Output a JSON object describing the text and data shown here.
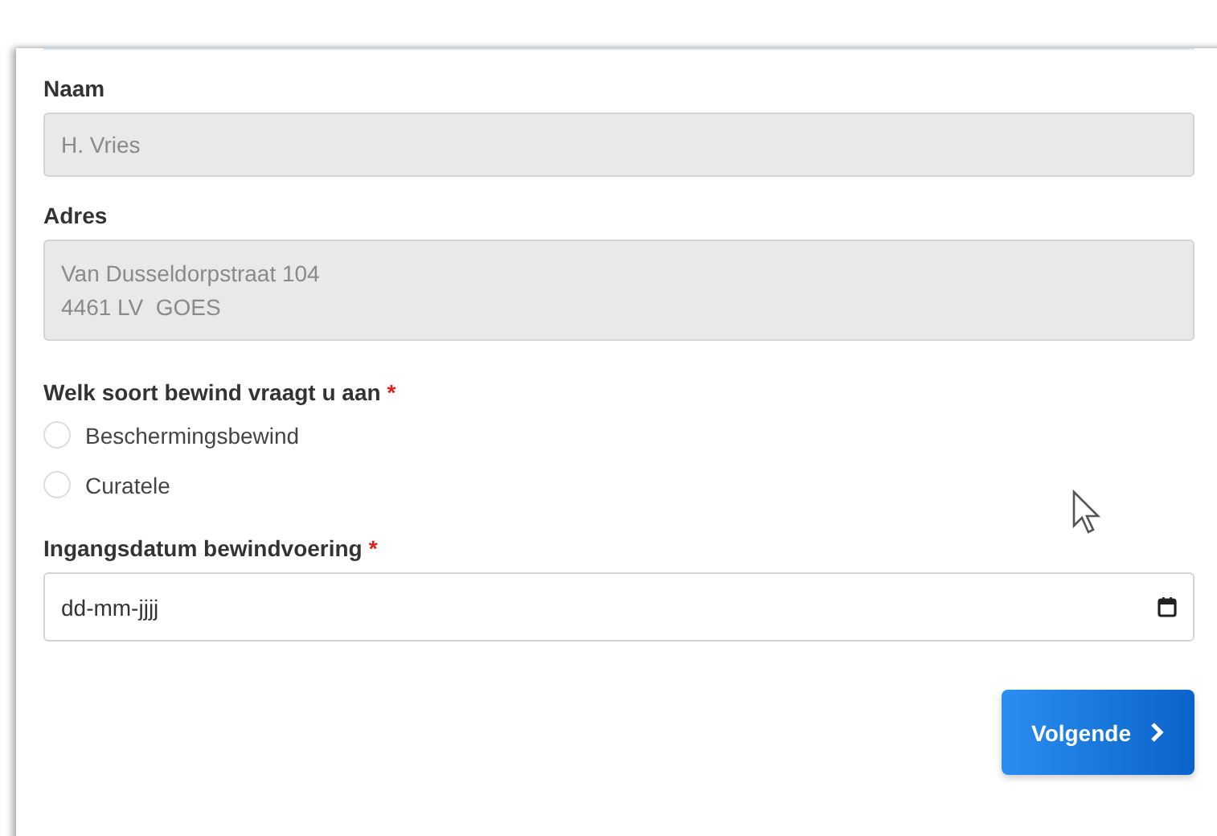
{
  "fields": [
    {
      "kind": "text",
      "label": "Naam",
      "required": false,
      "disabled": true,
      "value": "H. Vries"
    },
    {
      "kind": "textarea",
      "label": "Adres",
      "required": false,
      "disabled": true,
      "lines": [
        "Van Dusseldorpstraat 104",
        "4461 LV  GOES"
      ]
    },
    {
      "kind": "radio",
      "label": "Welk soort bewind vraagt u aan",
      "required": true,
      "options": [
        {
          "label": "Beschermingsbewind",
          "selected": false
        },
        {
          "label": "Curatele",
          "selected": false
        }
      ]
    },
    {
      "kind": "date",
      "label": "Ingangsdatum bewindvoering",
      "required": true,
      "placeholder": "dd-mm-jjjj"
    }
  ],
  "required_mark": "*",
  "next_button": {
    "label": "Volgende"
  }
}
